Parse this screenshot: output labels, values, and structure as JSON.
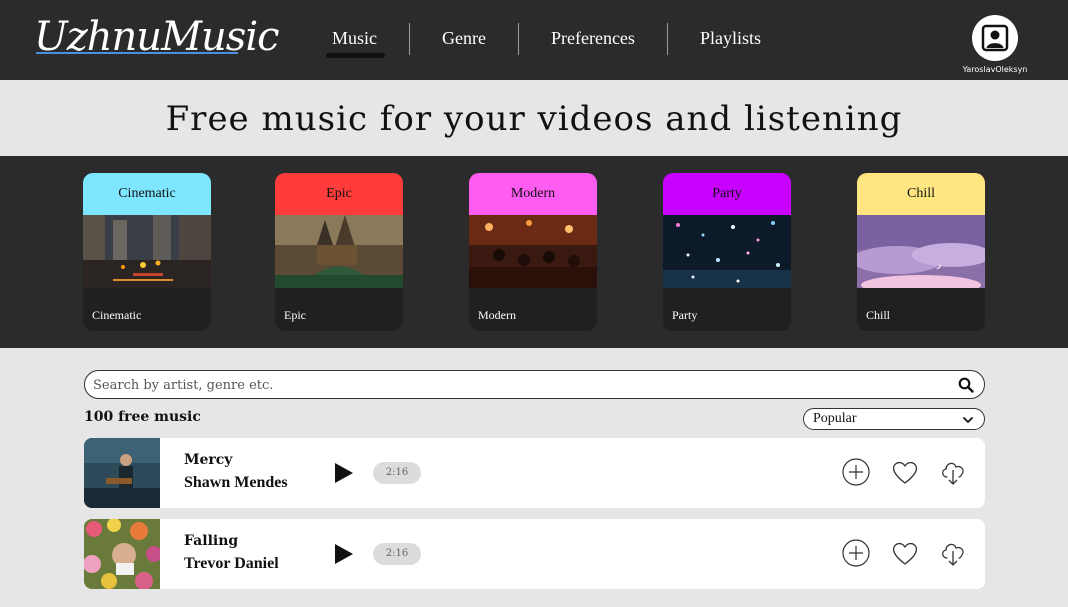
{
  "header": {
    "logo": "UzhnuMusic",
    "nav": [
      {
        "label": "Music",
        "active": true
      },
      {
        "label": "Genre",
        "active": false
      },
      {
        "label": "Preferences",
        "active": false
      },
      {
        "label": "Playlists",
        "active": false
      }
    ],
    "username": "YaroslavOleksyn"
  },
  "hero": {
    "title": "Free music for your videos and listening"
  },
  "genres": [
    {
      "title": "Cinematic",
      "label": "Cinematic",
      "color": "#7fe6ff"
    },
    {
      "title": "Epic",
      "label": "Epic",
      "color": "#ff3b3b"
    },
    {
      "title": "Modern",
      "label": "Modern",
      "color": "#ff5cf2"
    },
    {
      "title": "Party",
      "label": "Party",
      "color": "#c800ff"
    },
    {
      "title": "Chill",
      "label": "Chill",
      "color": "#ffe680"
    }
  ],
  "search": {
    "placeholder": "Search by artist, genre etc.",
    "value": ""
  },
  "list": {
    "count_label": "100 free music",
    "sort": {
      "selected": "Popular"
    },
    "tracks": [
      {
        "title": "Mercy",
        "artist": "Shawn Mendes",
        "duration": "2:16"
      },
      {
        "title": "Falling",
        "artist": "Trevor Daniel",
        "duration": "2:16"
      }
    ]
  },
  "icons": {
    "avatar": "user-icon",
    "search": "search-icon",
    "sort": "chevron-down-icon",
    "play": "play-icon",
    "add": "plus-circle-icon",
    "like": "heart-icon",
    "download": "cloud-download-icon"
  }
}
